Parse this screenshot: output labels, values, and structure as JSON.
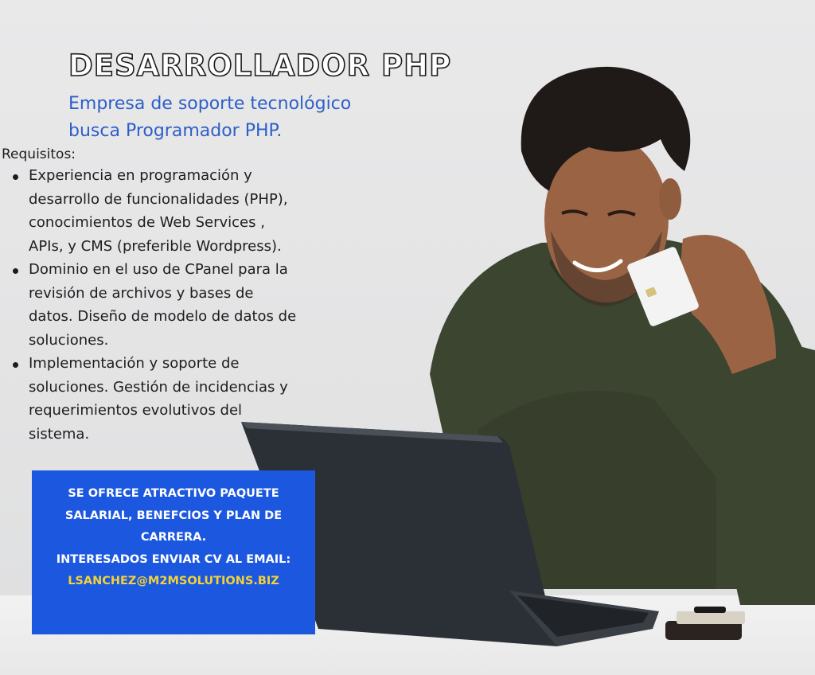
{
  "header": {
    "title": "DESARROLLADOR PHP",
    "subtitle_line1": "Empresa de soporte tecnológico",
    "subtitle_line2": "busca Programador PHP."
  },
  "requirements": {
    "label": "Requisitos:",
    "items": [
      [
        "Experiencia en programación y",
        "desarrollo de funcionalidades (PHP),",
        "conocimientos de Web Services ,",
        "APIs, y CMS (preferible Wordpress)."
      ],
      [
        "Dominio en el uso de CPanel para la",
        "revisión de archivos y bases de",
        "datos. Diseño de modelo de datos de",
        "soluciones."
      ],
      [
        "Implementación y soporte de",
        "soluciones. Gestión de incidencias y",
        "requerimientos evolutivos del",
        "sistema."
      ]
    ]
  },
  "offer": {
    "line1": "SE OFRECE ATRACTIVO PAQUETE",
    "line2": "SALARIAL, BENEFCIOS Y PLAN DE",
    "line3": "CARRERA.",
    "line4": "INTERESADOS ENVIAR CV AL EMAIL:",
    "email": "LSANCHEZ@M2MSOLUTIONS.BIZ"
  },
  "colors": {
    "accent_blue": "#2d5fc8",
    "box_blue": "#1c57e0",
    "email_yellow": "#f3d238",
    "sweater": "#3c4530"
  }
}
